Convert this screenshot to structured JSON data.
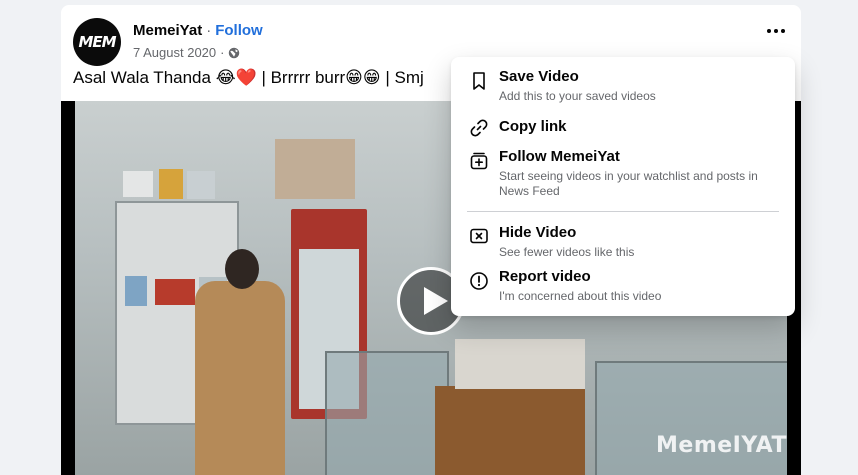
{
  "post": {
    "author": "MemeiYat",
    "separator": "·",
    "follow_label": "Follow",
    "date": "7 August 2020",
    "date_separator": "·",
    "privacy_icon": "globe-icon",
    "caption": "Asal Wala Thanda 😂❤️ | Brrrrr burr😁😁 | Smj",
    "avatar_text": "MEM",
    "more_icon": "more-options-icon"
  },
  "video": {
    "watermark": "MemeIYAT",
    "play_icon": "play-icon"
  },
  "menu": {
    "items": [
      {
        "icon": "bookmark-icon",
        "title": "Save Video",
        "subtitle": "Add this to your saved videos"
      },
      {
        "icon": "link-icon",
        "title": "Copy link",
        "subtitle": ""
      },
      {
        "icon": "follow-plus-icon",
        "title": "Follow MemeiYat",
        "subtitle": "Start seeing videos in your watchlist and posts in News Feed"
      },
      {
        "icon": "hide-x-icon",
        "title": "Hide Video",
        "subtitle": "See fewer videos like this"
      },
      {
        "icon": "report-alert-icon",
        "title": "Report video",
        "subtitle": "I'm concerned about this video"
      }
    ]
  },
  "colors": {
    "link_blue": "#216fdb",
    "muted_text": "#65676b",
    "page_background": "#f0f2f5"
  }
}
